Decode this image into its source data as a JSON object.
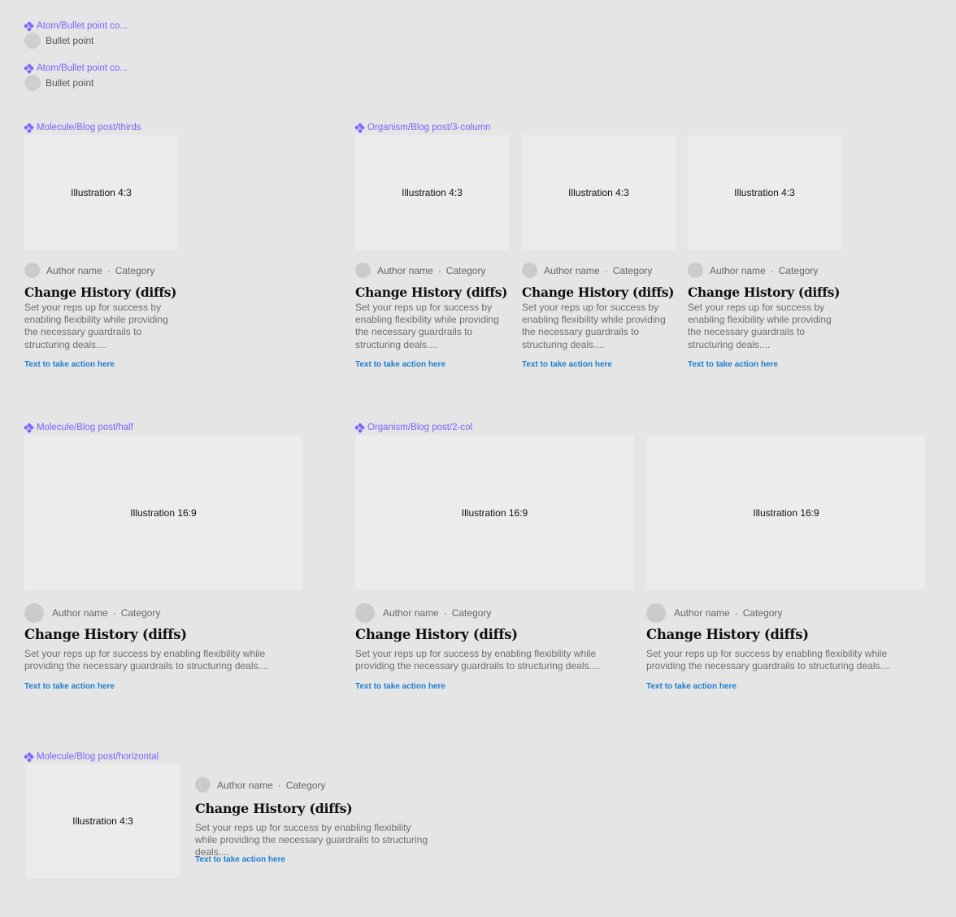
{
  "bullet_components": [
    {
      "component_label": "Atom/Bullet point co...",
      "text": "Bullet point"
    },
    {
      "component_label": "Atom/Bullet point co...",
      "text": "Bullet point"
    }
  ],
  "frames": {
    "thirds": {
      "label": "Molecule/Blog post/thirds"
    },
    "three_column": {
      "label": "Organism/Blog post/3-column"
    },
    "half": {
      "label": "Molecule/Blog post/half"
    },
    "two_col": {
      "label": "Organism/Blog post/2-col"
    },
    "horizontal": {
      "label": "Molecule/Blog post/horizontal"
    }
  },
  "illustrations": {
    "four_three": "Illustration 4:3",
    "sixteen_nine": "Illustration 16:9"
  },
  "post": {
    "author": "Author name",
    "separator": "·",
    "category": "Category",
    "title": "Change History (diffs)",
    "excerpt": "Set your reps up for success by enabling flexibility while providing the necessary guardrails to structuring deals....",
    "cta": "Text to take action here"
  },
  "colors": {
    "canvas": "#e5e5e5",
    "component_label": "#7b61ff",
    "placeholder": "#ececec",
    "link": "#1c7fd0"
  },
  "icons": {
    "component": "component-icon",
    "avatar": "avatar-placeholder"
  }
}
